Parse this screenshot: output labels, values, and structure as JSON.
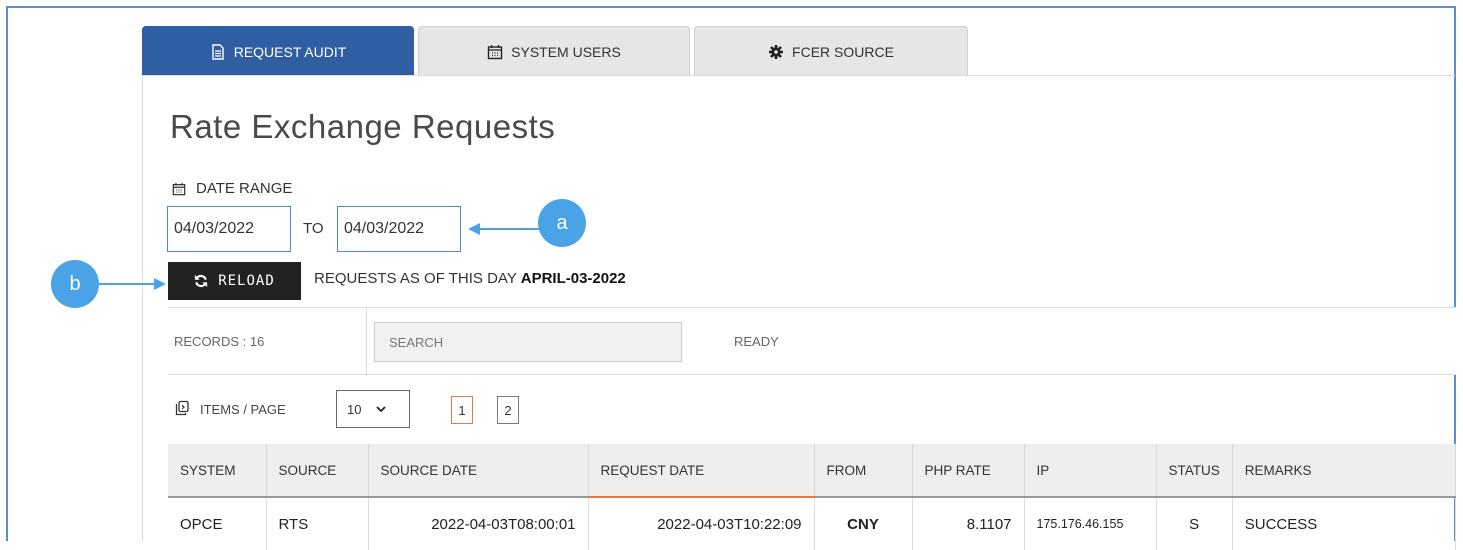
{
  "tabs": [
    {
      "label": "REQUEST AUDIT",
      "icon": "document-icon",
      "active": true
    },
    {
      "label": "SYSTEM USERS",
      "icon": "calendar-icon",
      "active": false
    },
    {
      "label": "FCER SOURCE",
      "icon": "gear-icon",
      "active": false
    }
  ],
  "page": {
    "title": "Rate Exchange Requests"
  },
  "date_range": {
    "label": "DATE RANGE",
    "from": "04/03/2022",
    "to_label": "TO",
    "to": "04/03/2022"
  },
  "callouts": {
    "a": "a",
    "b": "b"
  },
  "reload": {
    "label": "RELOAD"
  },
  "as_of": {
    "prefix": "REQUESTS AS OF THIS DAY",
    "date": "APRIL-03-2022"
  },
  "toolbar": {
    "records": "RECORDS : 16",
    "search_placeholder": "SEARCH",
    "status": "READY"
  },
  "pager": {
    "items_per_page_label": "ITEMS / PAGE",
    "items_per_page": "10",
    "pages": [
      "1",
      "2"
    ],
    "current_page": "1"
  },
  "table": {
    "columns": [
      "SYSTEM",
      "SOURCE",
      "SOURCE DATE",
      "REQUEST DATE",
      "FROM",
      "PHP RATE",
      "IP",
      "STATUS",
      "REMARKS"
    ],
    "sorted_column": "REQUEST DATE",
    "rows": [
      [
        "OPCE",
        "RTS",
        "2022-04-03T08:00:01",
        "2022-04-03T10:22:09",
        "CNY",
        "8.1107",
        "175.176.46.155",
        "S",
        "SUCCESS"
      ]
    ]
  },
  "colors": {
    "tab_active": "#2f5ea2",
    "callout": "#4aa3e6",
    "sort_indicator": "#e8793f"
  }
}
